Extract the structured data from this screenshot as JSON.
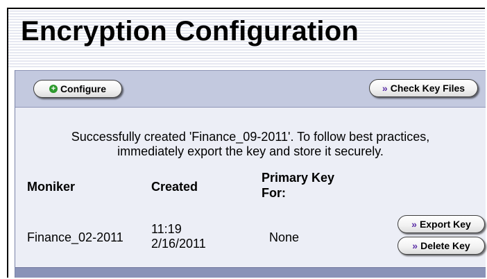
{
  "page": {
    "title": "Encryption Configuration"
  },
  "toolbar": {
    "configure_label": "Configure",
    "check_key_files_label": "Check Key Files"
  },
  "message": {
    "line1": "Successfully created 'Finance_09-2011'. To follow best practices,",
    "line2": "immediately export the key and store it securely."
  },
  "table": {
    "headers": {
      "moniker": "Moniker",
      "created": "Created",
      "primary_key_line1": "Primary Key",
      "primary_key_line2": "For:"
    },
    "rows": [
      {
        "moniker": "Finance_02-2011",
        "created_time": "11:19",
        "created_date": "2/16/2011",
        "primary_key_for": "None",
        "export_label": "Export Key",
        "delete_label": "Delete Key"
      }
    ]
  },
  "icons": {
    "configure": "plus-circle-icon",
    "check_key_files": "double-chevron-right-icon",
    "export_key": "double-chevron-right-icon",
    "delete_key": "double-chevron-right-icon"
  },
  "colors": {
    "toolbar_bg": "#c3c9df",
    "panel_bg": "#eceef6",
    "footer_band": "#8a93b8",
    "plus_icon": "#2e9a2e",
    "chevron_icon": "#5b2ea6"
  }
}
